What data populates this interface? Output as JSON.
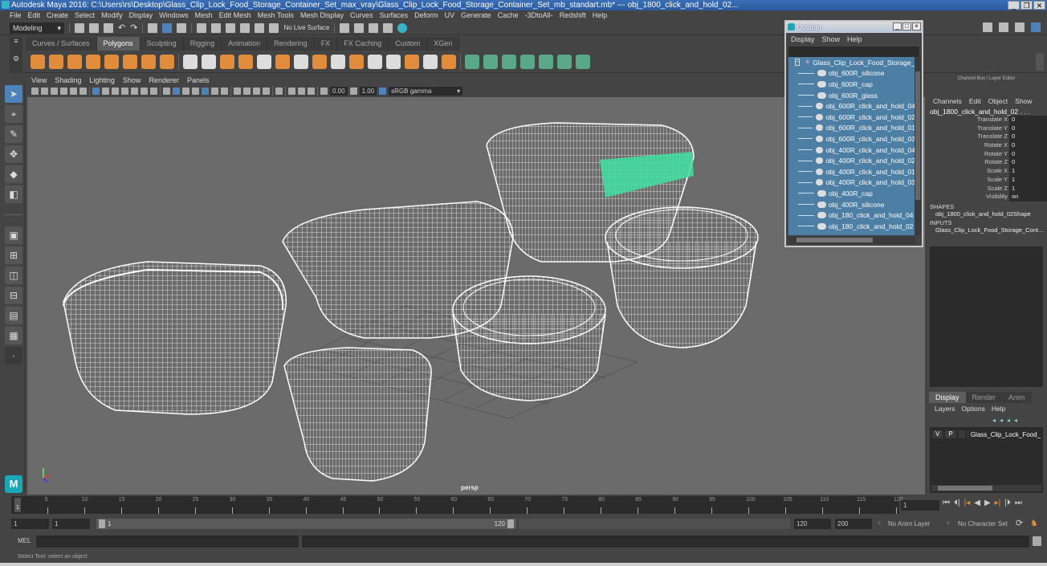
{
  "window": {
    "title": "Autodesk Maya 2016: C:\\Users\\rs\\Desktop\\Glass_Clip_Lock_Food_Storage_Container_Set_max_vray\\Glass_Clip_Lock_Food_Storage_Container_Set_mb_standart.mb*  ---  obj_1800_click_and_hold_02...",
    "controls": [
      "_",
      "❐",
      "✕"
    ]
  },
  "menubar": [
    "File",
    "Edit",
    "Create",
    "Select",
    "Modify",
    "Display",
    "Windows",
    "Mesh",
    "Edit Mesh",
    "Mesh Tools",
    "Mesh Display",
    "Curves",
    "Surfaces",
    "Deform",
    "UV",
    "Generate",
    "Cache",
    "-3DtoAll-",
    "Redshift",
    "Help"
  ],
  "statusline": {
    "mode": "Modeling",
    "live_surface": "No Live Surface"
  },
  "shelf": {
    "tabs": [
      "Curves / Surfaces",
      "Polygons",
      "Sculpting",
      "Rigging",
      "Animation",
      "Rendering",
      "FX",
      "FX Caching",
      "Custom",
      "XGen"
    ],
    "active_tab": "Polygons"
  },
  "panel": {
    "menu": [
      "View",
      "Shading",
      "Lighting",
      "Show",
      "Renderer",
      "Panels"
    ],
    "exposure": "0.00",
    "gamma": "1.00",
    "color_space": "sRGB gamma",
    "camera_label": "persp"
  },
  "outliner": {
    "title": "Outliner",
    "controls": [
      "_",
      "□",
      "×"
    ],
    "menu": [
      "Display",
      "Show",
      "Help"
    ],
    "root": "Glass_Clip_Lock_Food_Storage_C",
    "items": [
      "obj_600R_silicone",
      "obj_600R_cap",
      "obj_600R_glass",
      "obj_600R_click_and_hold_04",
      "obj_600R_click_and_hold_02",
      "obj_600R_click_and_hold_01",
      "obj_600R_click_and_hold_03",
      "obj_400R_click_and_hold_04",
      "obj_400R_click_and_hold_02",
      "obj_400R_click_and_hold_01",
      "obj_400R_click_and_hold_03",
      "obj_400R_cap",
      "obj_400R_silicone",
      "obj_180_click_and_hold_04",
      "obj_180_click_and_hold_02"
    ]
  },
  "channel_box": {
    "header": "Channel Box / Layer Editor",
    "menu": [
      "Channels",
      "Edit",
      "Object",
      "Show"
    ],
    "object": "obj_1800_click_and_hold_02 . . .",
    "attributes": [
      {
        "name": "Translate X",
        "value": "0"
      },
      {
        "name": "Translate Y",
        "value": "0"
      },
      {
        "name": "Translate Z",
        "value": "0"
      },
      {
        "name": "Rotate X",
        "value": "0"
      },
      {
        "name": "Rotate Y",
        "value": "0"
      },
      {
        "name": "Rotate Z",
        "value": "0"
      },
      {
        "name": "Scale X",
        "value": "1"
      },
      {
        "name": "Scale Y",
        "value": "1"
      },
      {
        "name": "Scale Z",
        "value": "1"
      },
      {
        "name": "Visibility",
        "value": "on"
      }
    ],
    "shapes_label": "SHAPES",
    "shape": "obj_1800_click_and_hold_02Shape",
    "inputs_label": "INPUTS",
    "input": "Glass_Clip_Lock_Food_Storage_Cont..."
  },
  "layer_editor": {
    "tabs": [
      "Display",
      "Render",
      "Anim"
    ],
    "active_tab": "Display",
    "menu": [
      "Layers",
      "Options",
      "Help"
    ],
    "layer": {
      "v": "V",
      "p": "P",
      "name": "Glass_Clip_Lock_Food_",
      "color": "#c00020"
    }
  },
  "timeline": {
    "ticks": [
      "5",
      "10",
      "15",
      "20",
      "25",
      "30",
      "35",
      "40",
      "45",
      "50",
      "55",
      "60",
      "65",
      "70",
      "75",
      "80",
      "85",
      "90",
      "95",
      "100",
      "105",
      "110",
      "115",
      "120"
    ],
    "start_marker": "1",
    "current_frame": "1"
  },
  "range": {
    "start": "1",
    "playback_start": "1",
    "slider_start": "1",
    "slider_end": "120",
    "playback_end": "120",
    "end": "200",
    "anim_layer": "No Anim Layer",
    "character_set": "No Character Set"
  },
  "mel": {
    "label": "MEL"
  },
  "status": {
    "help_line": "Select Tool: select an object"
  },
  "colors": {
    "accent": "#4d83ba",
    "selection": "#3fe0a0",
    "outliner_bg": "#4d7fa5"
  }
}
